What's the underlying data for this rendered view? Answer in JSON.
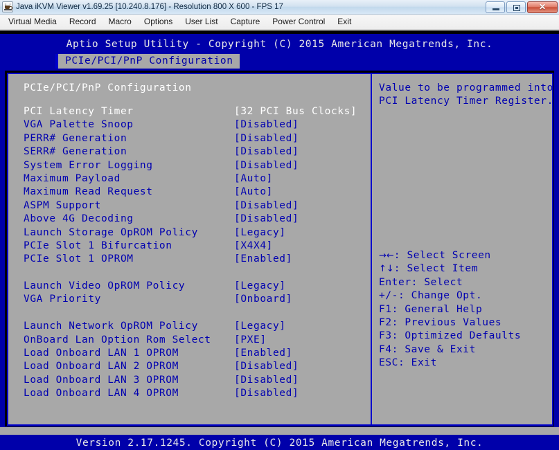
{
  "window": {
    "title": "Java iKVM Viewer v1.69.25 [10.240.8.176]  - Resolution 800 X 600 - FPS 17",
    "icon": "java-coffee-cup-icon",
    "buttons": {
      "minimize": "minimize-button",
      "maximize": "maximize-button",
      "close_label": "✕"
    }
  },
  "menubar": {
    "items": [
      {
        "label": "Virtual Media"
      },
      {
        "label": "Record"
      },
      {
        "label": "Macro"
      },
      {
        "label": "Options"
      },
      {
        "label": "User List"
      },
      {
        "label": "Capture"
      },
      {
        "label": "Power Control"
      },
      {
        "label": "Exit"
      }
    ]
  },
  "bios": {
    "title": "Aptio Setup Utility - Copyright (C) 2015 American Megatrends, Inc.",
    "active_tab": "PCIe/PCI/PnP Configuration",
    "section_heading": "PCIe/PCI/PnP Configuration",
    "footer": "Version 2.17.1245. Copyright (C) 2015 American Megatrends, Inc.",
    "colors": {
      "screen_blue": "#0000aa",
      "panel_gray": "#a8a8a8",
      "item_blue": "#0000b0",
      "selected_white": "#ffffff",
      "border_blue": "#0000cc"
    },
    "settings": [
      {
        "label": "PCI Latency Timer",
        "value": "[32 PCI Bus Clocks]",
        "selected": true
      },
      {
        "label": "VGA Palette Snoop",
        "value": "[Disabled]",
        "selected": false
      },
      {
        "label": "PERR# Generation",
        "value": "[Disabled]",
        "selected": false
      },
      {
        "label": "SERR# Generation",
        "value": "[Disabled]",
        "selected": false
      },
      {
        "label": "System Error Logging",
        "value": "[Disabled]",
        "selected": false
      },
      {
        "label": "Maximum Payload",
        "value": "[Auto]",
        "selected": false
      },
      {
        "label": "Maximum Read Request",
        "value": "[Auto]",
        "selected": false
      },
      {
        "label": "ASPM Support",
        "value": "[Disabled]",
        "selected": false
      },
      {
        "label": "Above 4G Decoding",
        "value": "[Disabled]",
        "selected": false
      },
      {
        "label": "Launch Storage OpROM Policy",
        "value": "[Legacy]",
        "selected": false
      },
      {
        "label": "PCIe Slot 1 Bifurcation",
        "value": "[X4X4]",
        "selected": false
      },
      {
        "label": "PCIe Slot 1 OPROM",
        "value": "[Enabled]",
        "selected": false
      },
      {
        "label": "",
        "value": "",
        "selected": false
      },
      {
        "label": "Launch Video OpROM Policy",
        "value": "[Legacy]",
        "selected": false
      },
      {
        "label": "VGA Priority",
        "value": "[Onboard]",
        "selected": false
      },
      {
        "label": "",
        "value": "",
        "selected": false
      },
      {
        "label": "Launch Network OpROM Policy",
        "value": "[Legacy]",
        "selected": false
      },
      {
        "label": "OnBoard Lan Option Rom Select",
        "value": "[PXE]",
        "selected": false
      },
      {
        "label": "Load Onboard LAN 1 OPROM",
        "value": "[Enabled]",
        "selected": false
      },
      {
        "label": "Load Onboard LAN 2 OPROM",
        "value": "[Disabled]",
        "selected": false
      },
      {
        "label": "Load Onboard LAN 3 OPROM",
        "value": "[Disabled]",
        "selected": false
      },
      {
        "label": "Load Onboard LAN 4 OPROM",
        "value": "[Disabled]",
        "selected": false
      }
    ],
    "help": {
      "lines": [
        "Value to be programmed into",
        "PCI Latency Timer Register."
      ]
    },
    "key_legend": [
      {
        "keys": "→←",
        "text": ": Select Screen",
        "arrow": true
      },
      {
        "keys": "↑↓",
        "text": ": Select Item",
        "arrow": true
      },
      {
        "keys": "",
        "text": "Enter: Select",
        "arrow": false
      },
      {
        "keys": "",
        "text": "+/-: Change Opt.",
        "arrow": false
      },
      {
        "keys": "",
        "text": "F1: General Help",
        "arrow": false
      },
      {
        "keys": "",
        "text": "F2: Previous Values",
        "arrow": false
      },
      {
        "keys": "",
        "text": "F3: Optimized Defaults",
        "arrow": false
      },
      {
        "keys": "",
        "text": "F4: Save & Exit",
        "arrow": false
      },
      {
        "keys": "",
        "text": "ESC: Exit",
        "arrow": false
      }
    ]
  }
}
